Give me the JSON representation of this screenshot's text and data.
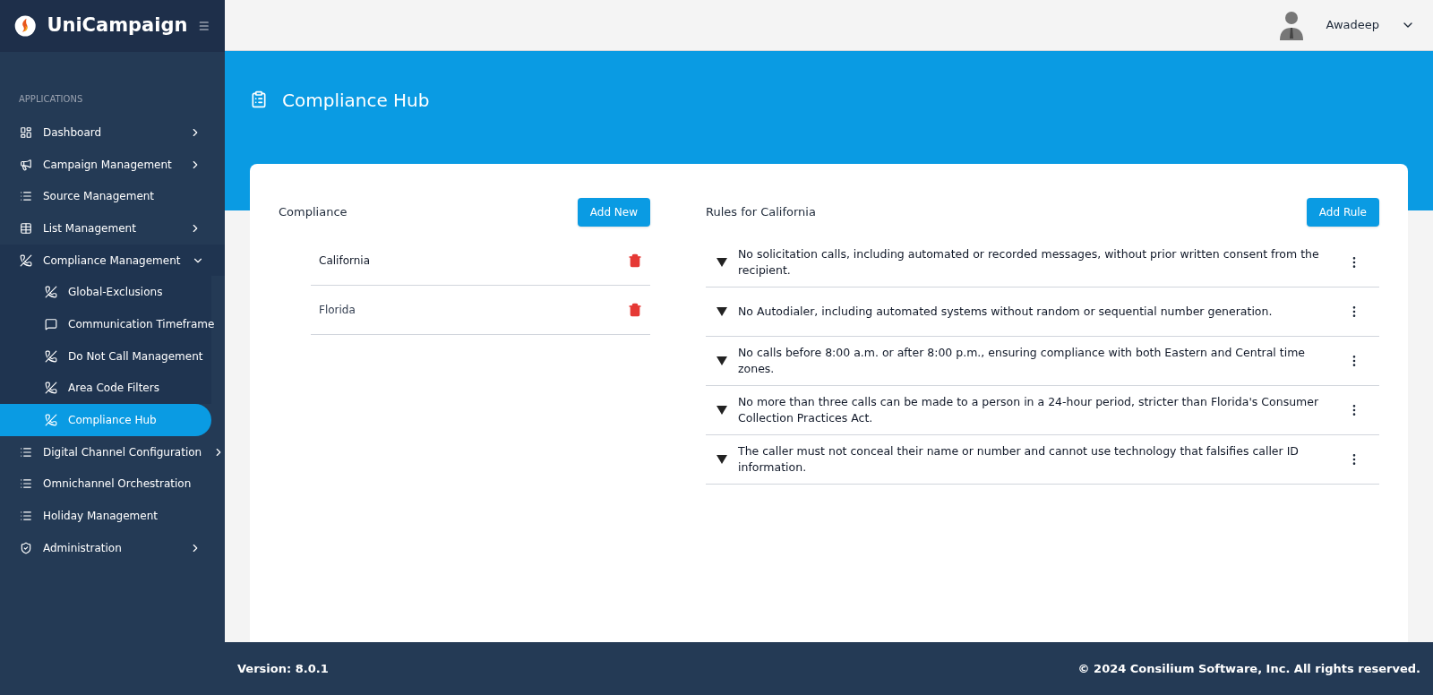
{
  "brand": {
    "name": "UniCampaign"
  },
  "user": {
    "name": "Awadeep"
  },
  "sidebar": {
    "section": "APPLICATIONS",
    "items": [
      {
        "label": "Dashboard",
        "expanded": false
      },
      {
        "label": "Campaign Management",
        "expanded": false
      },
      {
        "label": "Source Management"
      },
      {
        "label": "List Management",
        "expanded": false
      },
      {
        "label": "Compliance Management",
        "expanded": true,
        "children": [
          {
            "label": "Global-Exclusions",
            "selected": false
          },
          {
            "label": "Communication Timeframe",
            "selected": false
          },
          {
            "label": "Do Not Call Management",
            "selected": false
          },
          {
            "label": "Area Code Filters",
            "selected": false
          },
          {
            "label": "Compliance Hub",
            "selected": true
          }
        ]
      },
      {
        "label": "Digital Channel Configuration",
        "expanded": false
      },
      {
        "label": "Omnichannel Orchestration"
      },
      {
        "label": "Holiday Management"
      },
      {
        "label": "Administration",
        "expanded": false
      }
    ]
  },
  "page": {
    "title": "Compliance Hub"
  },
  "compliance": {
    "title": "Compliance",
    "add_button": "Add New",
    "states": [
      {
        "name": "California",
        "selected": true
      },
      {
        "name": "Florida",
        "selected": false
      }
    ]
  },
  "rules": {
    "title": "Rules for California",
    "add_button": "Add Rule",
    "items": [
      "No solicitation calls, including automated or recorded messages, without prior written consent from the recipient.",
      "No Autodialer, including automated systems without random or sequential number generation.",
      "No calls before 8:00 a.m. or after 8:00 p.m., ensuring compliance with both Eastern and Central time zones.",
      "No more than three calls can be made to a person in a 24-hour period, stricter than Florida's Consumer Collection Practices Act.",
      "The caller must not conceal their name or number and cannot use technology that falsifies caller ID information."
    ]
  },
  "footer": {
    "version": "Version: 8.0.1",
    "copyright": "© 2024 Consilium Software, Inc. All rights reserved."
  }
}
